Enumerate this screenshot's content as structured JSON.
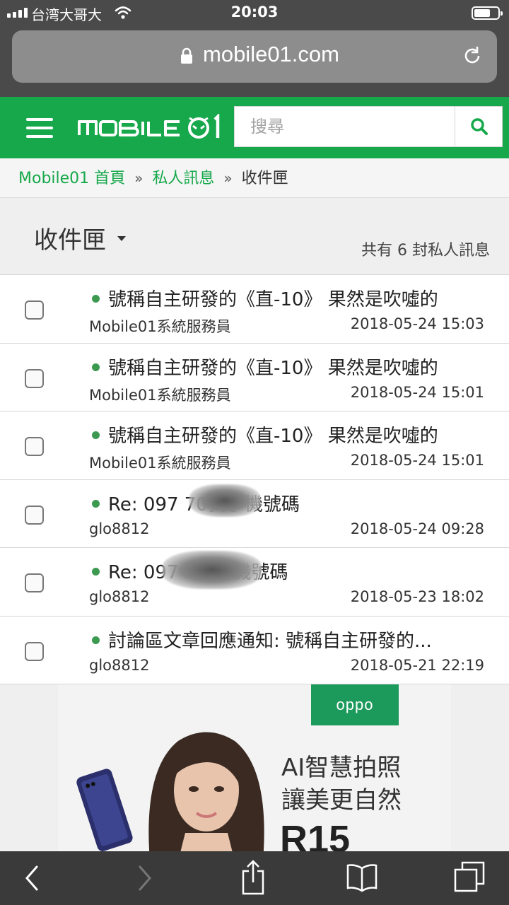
{
  "status_bar": {
    "carrier": "台湾大哥大",
    "time": "20:03"
  },
  "browser": {
    "url": "mobile01.com"
  },
  "header": {
    "logo_text": "MOBILE 01",
    "search_placeholder": "搜尋"
  },
  "breadcrumb": {
    "items": [
      "Mobile01 首頁",
      "私人訊息"
    ],
    "current": "收件匣",
    "separator": "»"
  },
  "inbox": {
    "title": "收件匣",
    "count_text": "共有 6 封私人訊息"
  },
  "messages": [
    {
      "subject": "號稱自主研發的《直-10》 果然是吹噓的",
      "sender": "Mobile01系統服務員",
      "date": "2018-05-24 15:03"
    },
    {
      "subject": "號稱自主研發的《直-10》 果然是吹噓的",
      "sender": "Mobile01系統服務員",
      "date": "2018-05-24 15:01"
    },
    {
      "subject": "號稱自主研發的《直-10》 果然是吹噓的",
      "sender": "Mobile01系統服務員",
      "date": "2018-05-24 15:01"
    },
    {
      "subject": "Re: 097        70我手機號碼",
      "sender": "glo8812",
      "date": "2018-05-24 09:28"
    },
    {
      "subject": "Re: 097        0我手機號碼",
      "sender": "glo8812",
      "date": "2018-05-23 18:02"
    },
    {
      "subject": "討論區文章回應通知: 號稱自主研發的...",
      "sender": "glo8812",
      "date": "2018-05-21 22:19"
    }
  ],
  "ad": {
    "brand": "oppo",
    "line1": "AI智慧拍照",
    "line2": "讓美更自然",
    "model": "R15"
  },
  "colors": {
    "brand_green": "#16a84a",
    "unread_dot": "#3b9a4f",
    "chrome_dark": "#4a4a4a"
  }
}
